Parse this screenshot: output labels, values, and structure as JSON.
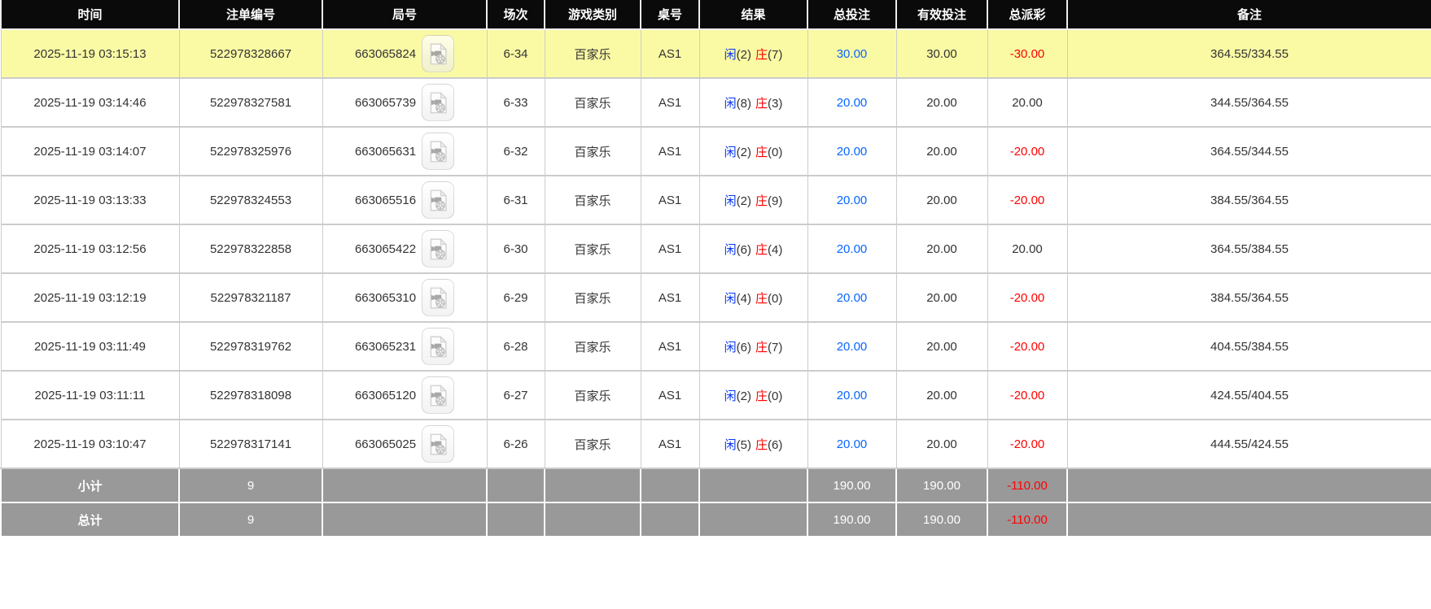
{
  "table": {
    "columns": [
      {
        "label": "时间"
      },
      {
        "label": "注单编号"
      },
      {
        "label": "局号"
      },
      {
        "label": "场次"
      },
      {
        "label": "游戏类别"
      },
      {
        "label": "桌号"
      },
      {
        "label": "结果"
      },
      {
        "label": "总投注"
      },
      {
        "label": "有效投注"
      },
      {
        "label": "总派彩"
      },
      {
        "label": "备注"
      }
    ],
    "rows": [
      {
        "time": "2025-11-19 03:15:13",
        "bet_id": "522978328667",
        "round_id": "663065824",
        "session": "6-34",
        "game_type": "百家乐",
        "table_no": "AS1",
        "player_label": "闲",
        "player_points": "(2)",
        "banker_label": "庄",
        "banker_points": "(7)",
        "total_bet": "30.00",
        "valid_bet": "30.00",
        "payout": "-30.00",
        "remark": "364.55/334.55",
        "highlight": true
      },
      {
        "time": "2025-11-19 03:14:46",
        "bet_id": "522978327581",
        "round_id": "663065739",
        "session": "6-33",
        "game_type": "百家乐",
        "table_no": "AS1",
        "player_label": "闲",
        "player_points": "(8)",
        "banker_label": "庄",
        "banker_points": "(3)",
        "total_bet": "20.00",
        "valid_bet": "20.00",
        "payout": "20.00",
        "remark": "344.55/364.55",
        "highlight": false
      },
      {
        "time": "2025-11-19 03:14:07",
        "bet_id": "522978325976",
        "round_id": "663065631",
        "session": "6-32",
        "game_type": "百家乐",
        "table_no": "AS1",
        "player_label": "闲",
        "player_points": "(2)",
        "banker_label": "庄",
        "banker_points": "(0)",
        "total_bet": "20.00",
        "valid_bet": "20.00",
        "payout": "-20.00",
        "remark": "364.55/344.55",
        "highlight": false
      },
      {
        "time": "2025-11-19 03:13:33",
        "bet_id": "522978324553",
        "round_id": "663065516",
        "session": "6-31",
        "game_type": "百家乐",
        "table_no": "AS1",
        "player_label": "闲",
        "player_points": "(2)",
        "banker_label": "庄",
        "banker_points": "(9)",
        "total_bet": "20.00",
        "valid_bet": "20.00",
        "payout": "-20.00",
        "remark": "384.55/364.55",
        "highlight": false
      },
      {
        "time": "2025-11-19 03:12:56",
        "bet_id": "522978322858",
        "round_id": "663065422",
        "session": "6-30",
        "game_type": "百家乐",
        "table_no": "AS1",
        "player_label": "闲",
        "player_points": "(6)",
        "banker_label": "庄",
        "banker_points": "(4)",
        "total_bet": "20.00",
        "valid_bet": "20.00",
        "payout": "20.00",
        "remark": "364.55/384.55",
        "highlight": false
      },
      {
        "time": "2025-11-19 03:12:19",
        "bet_id": "522978321187",
        "round_id": "663065310",
        "session": "6-29",
        "game_type": "百家乐",
        "table_no": "AS1",
        "player_label": "闲",
        "player_points": "(4)",
        "banker_label": "庄",
        "banker_points": "(0)",
        "total_bet": "20.00",
        "valid_bet": "20.00",
        "payout": "-20.00",
        "remark": "384.55/364.55",
        "highlight": false
      },
      {
        "time": "2025-11-19 03:11:49",
        "bet_id": "522978319762",
        "round_id": "663065231",
        "session": "6-28",
        "game_type": "百家乐",
        "table_no": "AS1",
        "player_label": "闲",
        "player_points": "(6)",
        "banker_label": "庄",
        "banker_points": "(7)",
        "total_bet": "20.00",
        "valid_bet": "20.00",
        "payout": "-20.00",
        "remark": "404.55/384.55",
        "highlight": false
      },
      {
        "time": "2025-11-19 03:11:11",
        "bet_id": "522978318098",
        "round_id": "663065120",
        "session": "6-27",
        "game_type": "百家乐",
        "table_no": "AS1",
        "player_label": "闲",
        "player_points": "(2)",
        "banker_label": "庄",
        "banker_points": "(0)",
        "total_bet": "20.00",
        "valid_bet": "20.00",
        "payout": "-20.00",
        "remark": "424.55/404.55",
        "highlight": false
      },
      {
        "time": "2025-11-19 03:10:47",
        "bet_id": "522978317141",
        "round_id": "663065025",
        "session": "6-26",
        "game_type": "百家乐",
        "table_no": "AS1",
        "player_label": "闲",
        "player_points": "(5)",
        "banker_label": "庄",
        "banker_points": "(6)",
        "total_bet": "20.00",
        "valid_bet": "20.00",
        "payout": "-20.00",
        "remark": "444.55/424.55",
        "highlight": false
      }
    ],
    "footer": [
      {
        "label": "小计",
        "count": "9",
        "total_bet": "190.00",
        "valid_bet": "190.00",
        "payout": "-110.00"
      },
      {
        "label": "总计",
        "count": "9",
        "total_bet": "190.00",
        "valid_bet": "190.00",
        "payout": "-110.00"
      }
    ]
  },
  "icons": {
    "video_replay": "video-file-icon"
  },
  "colors": {
    "header_bg": "#0a0a0a",
    "header_text": "#ffffff",
    "highlight_row_bg": "#fafaa5",
    "row_bg": "#ffffff",
    "border": "#cccccc",
    "footer_bg": "#999999",
    "footer_text": "#ffffff",
    "player_blue": "#0837f0",
    "banker_red": "#ff0000",
    "amount_blue": "#0866ff",
    "negative_red": "#ff0000",
    "text": "#333333"
  }
}
